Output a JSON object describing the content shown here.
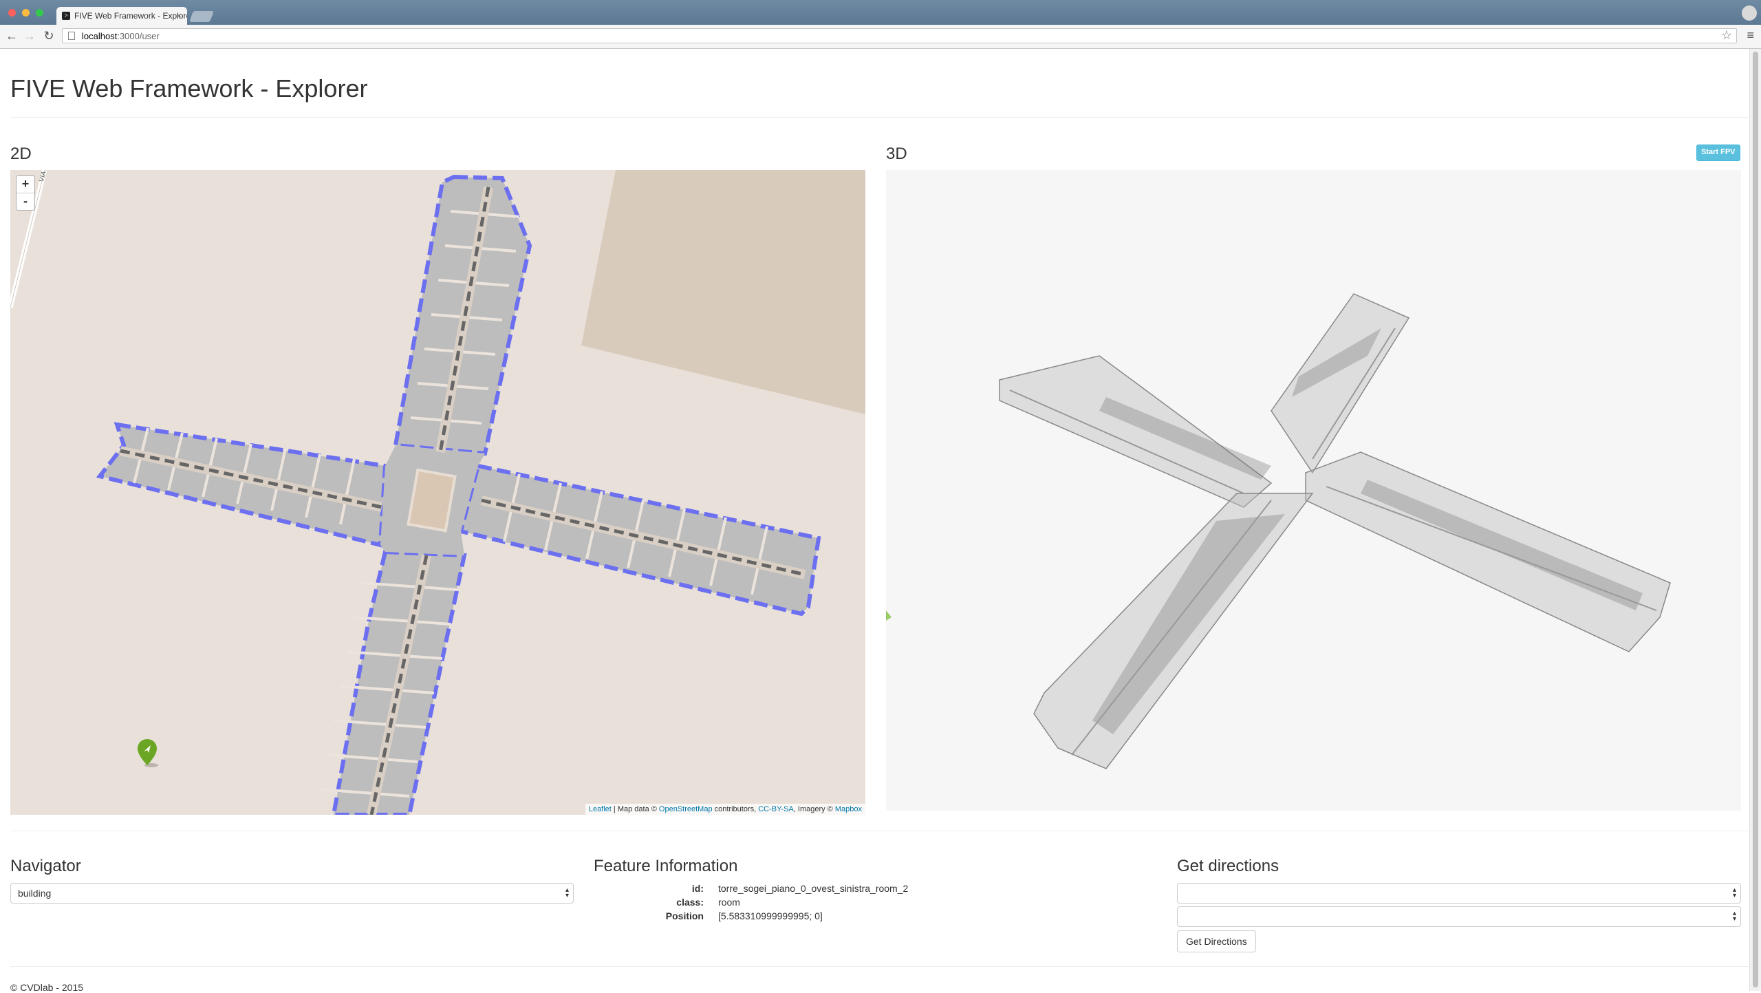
{
  "browser": {
    "tab_title": "FIVE Web Framework - Explorer",
    "tab_close": "×",
    "url": "localhost:3000/user",
    "url_host": "localhost",
    "url_rest": ":3000/user"
  },
  "page": {
    "title": "FIVE Web Framework - Explorer",
    "section_2d": "2D",
    "section_3d": "3D",
    "start_fpv": "Start FPV"
  },
  "map": {
    "zoom_in": "+",
    "zoom_out": "-",
    "attribution": {
      "leaflet": "Leaflet",
      "sep1": " | Map data © ",
      "osm": "OpenStreetMap",
      "contrib": " contributors, ",
      "license": "CC-BY-SA",
      "imagery": ", Imagery © ",
      "mapbox": "Mapbox"
    },
    "road_label": "VIA"
  },
  "navigator": {
    "heading": "Navigator",
    "selected": "building"
  },
  "feature": {
    "heading": "Feature Information",
    "rows": [
      {
        "key": "id:",
        "value": "torre_sogei_piano_0_ovest_sinistra_room_2"
      },
      {
        "key": "class:",
        "value": "room"
      },
      {
        "key": "Position",
        "value": "[5.583310999999995; 0]"
      }
    ]
  },
  "directions": {
    "heading": "Get directions",
    "from": "",
    "to": "",
    "button": "Get Directions"
  },
  "footer": "© CVDlab - 2015",
  "colors": {
    "map_bg": "#e9e1d9",
    "building": "#bdbdbd",
    "outline": "#6b6ff0",
    "corridor": "#666666",
    "marker": "#6aa623",
    "accent": "#5bc0de"
  }
}
